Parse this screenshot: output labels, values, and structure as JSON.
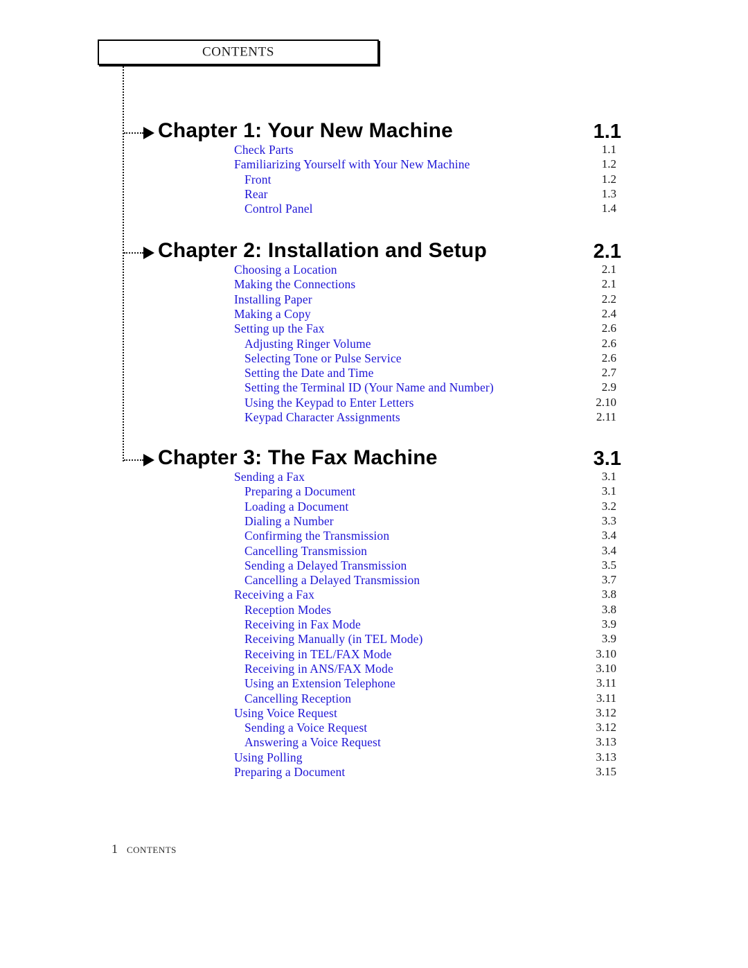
{
  "header": {
    "title": "CONTENTS"
  },
  "footer": {
    "page_number": "1",
    "label": "CONTENTS"
  },
  "colors": {
    "entry_blue": "#1f16d6",
    "heading_black": "#000000",
    "rule_black": "#1a1a1a"
  },
  "toc": {
    "chapters": [
      {
        "heading": "Chapter  1: Your  New  Machine",
        "page": "1.1",
        "entries": [
          {
            "label": "Check  Parts",
            "page": "1.1",
            "level": 1
          },
          {
            "label": "Familiarizing  Yourself  with  Your  New  Machine",
            "page": "1.2",
            "level": 1
          },
          {
            "label": "Front",
            "page": "1.2",
            "level": 2
          },
          {
            "label": "Rear",
            "page": "1.3",
            "level": 2
          },
          {
            "label": "Control  Panel",
            "page": "1.4",
            "level": 2
          }
        ]
      },
      {
        "heading": "Chapter  2: Installation  and  Setup",
        "page": "2.1",
        "entries": [
          {
            "label": "Choosing a  Location",
            "page": "2.1",
            "level": 1
          },
          {
            "label": "Making the Connections",
            "page": "2.1",
            "level": 1
          },
          {
            "label": "Installing Paper",
            "page": "2.2",
            "level": 1
          },
          {
            "label": "Making a Copy",
            "page": "2.4",
            "level": 1
          },
          {
            "label": "Setting up the Fax",
            "page": "2.6",
            "level": 1
          },
          {
            "label": "Adjusting Ringer  Volume",
            "page": "2.6",
            "level": 2
          },
          {
            "label": "Selecting Tone  or Pulse Service",
            "page": "2.6",
            "level": 2
          },
          {
            "label": "Setting the Date and Time",
            "page": "2.7",
            "level": 2
          },
          {
            "label": "Setting the Terminal ID (Your Name and Number)",
            "page": "2.9",
            "level": 2
          },
          {
            "label": "Using the Keypad to Enter Letters",
            "page": "2.10",
            "level": 2
          },
          {
            "label": "Keypad Character Assignments",
            "page": "2.11",
            "level": 2
          }
        ]
      },
      {
        "heading": "Chapter  3: The  Fax  Machine",
        "page": "3.1",
        "entries": [
          {
            "label": "Sending a Fax",
            "page": "3.1",
            "level": 1
          },
          {
            "label": "Preparing  a  Document",
            "page": "3.1",
            "level": 2
          },
          {
            "label": "Loading a Document",
            "page": "3.2",
            "level": 2
          },
          {
            "label": "Dialing a Number",
            "page": "3.3",
            "level": 2
          },
          {
            "label": "Confirming  the  Transmission",
            "page": "3.4",
            "level": 2
          },
          {
            "label": "Cancelling  Transmission",
            "page": "3.4",
            "level": 2
          },
          {
            "label": "Sending a Delayed Transmission",
            "page": "3.5",
            "level": 2
          },
          {
            "label": "Cancelling a Delayed Transmission",
            "page": "3.7",
            "level": 2
          },
          {
            "label": "Receiving a Fax",
            "page": "3.8",
            "level": 1
          },
          {
            "label": "Reception Modes",
            "page": "3.8",
            "level": 2
          },
          {
            "label": "Receiving in Fax Mode",
            "page": "3.9",
            "level": 2
          },
          {
            "label": "Receiving Manually (in TEL Mode)",
            "page": "3.9",
            "level": 2
          },
          {
            "label": "Receiving  in  TEL/FAX  Mode",
            "page": "3.10",
            "level": 2
          },
          {
            "label": "Receiving  in  ANS/FAX  Mode",
            "page": "3.10",
            "level": 2
          },
          {
            "label": "Using  an  Extension  Telephone",
            "page": "3.11",
            "level": 2
          },
          {
            "label": "Cancelling Reception",
            "page": "3.11",
            "level": 2
          },
          {
            "label": "Using Voice Request",
            "page": "3.12",
            "level": 1
          },
          {
            "label": "Sending a Voice Request",
            "page": "3.12",
            "level": 2
          },
          {
            "label": "Answering a Voice Request",
            "page": "3.13",
            "level": 2
          },
          {
            "label": "Using  Polling",
            "page": "3.13",
            "level": 1
          },
          {
            "label": "Preparing a Document",
            "page": "3.15",
            "level": 1
          }
        ]
      }
    ]
  }
}
